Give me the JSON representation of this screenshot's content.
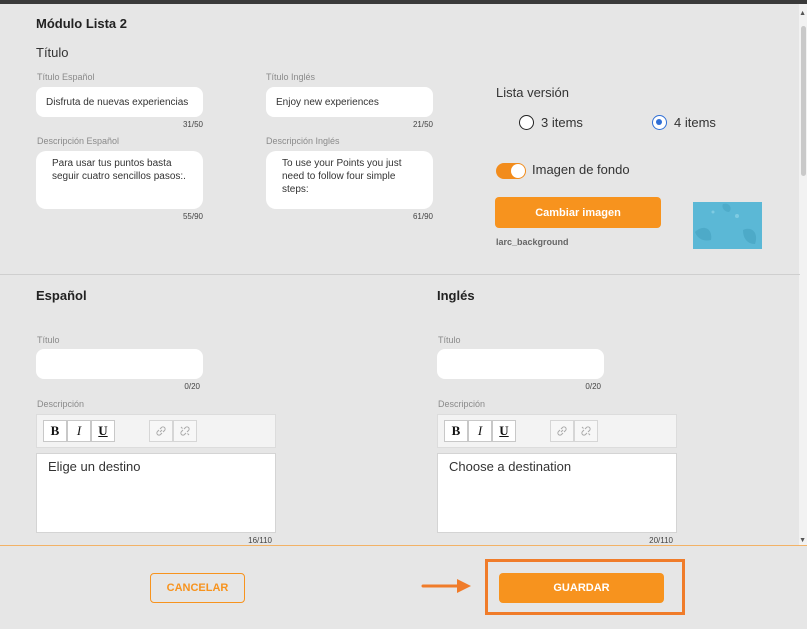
{
  "module": {
    "title": "Módulo Lista 2",
    "section_title": "Título"
  },
  "fields": {
    "title_es_label": "Título Español",
    "title_es_value": "Disfruta de nuevas experiencias",
    "title_es_counter": "31/50",
    "title_en_label": "Título Inglés",
    "title_en_value": "Enjoy new experiences",
    "title_en_counter": "21/50",
    "desc_es_label": "Descripción Español",
    "desc_es_value": "Para usar tus puntos basta seguir cuatro sencillos pasos:.",
    "desc_es_counter": "55/90",
    "desc_en_label": "Descripción Inglés",
    "desc_en_value": "To use your Points you just need to follow four simple steps:",
    "desc_en_counter": "61/90"
  },
  "list_version": {
    "label": "Lista versión",
    "option_3": "3 items",
    "option_4": "4 items",
    "selected": "4 items"
  },
  "background": {
    "toggle_label": "Imagen de fondo",
    "toggle_on": true,
    "change_button": "Cambiar imagen",
    "file_name": "larc_background",
    "thumb_color": "#5bb8d6"
  },
  "spanish": {
    "heading": "Español",
    "title_label": "Título",
    "title_value": "",
    "title_counter": "0/20",
    "desc_label": "Descripción",
    "desc_value": "Elige un destino",
    "desc_counter": "16/110"
  },
  "english": {
    "heading": "Inglés",
    "title_label": "Título",
    "title_value": "",
    "title_counter": "0/20",
    "desc_label": "Descripción",
    "desc_value": "Choose a destination",
    "desc_counter": "20/110"
  },
  "toolbar": {
    "bold": "B",
    "italic": "I",
    "underline": "U"
  },
  "footer": {
    "cancel": "CANCELAR",
    "save": "GUARDAR"
  },
  "colors": {
    "accent": "#f7931e",
    "radio_selected": "#2f6fd6",
    "highlight": "#f07c2a"
  }
}
